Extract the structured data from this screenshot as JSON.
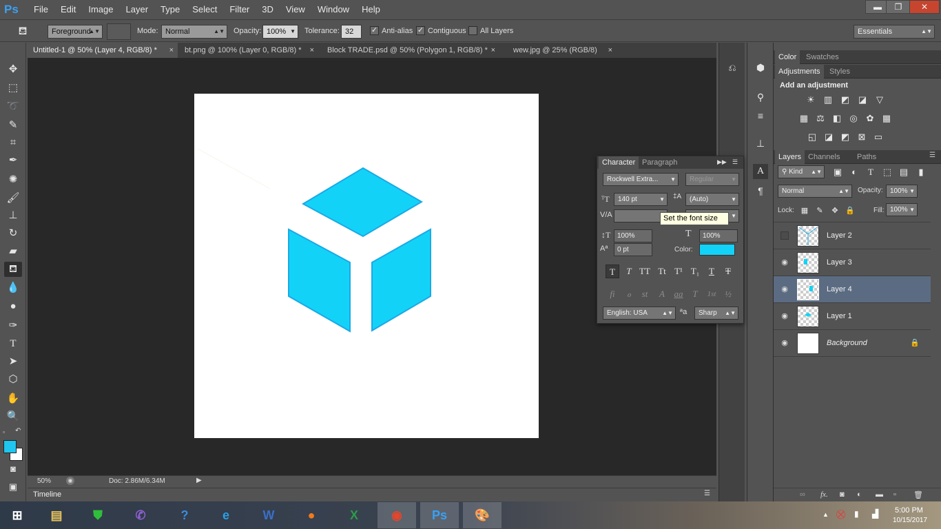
{
  "app": {
    "logo": "Ps"
  },
  "menu": [
    "File",
    "Edit",
    "Image",
    "Layer",
    "Type",
    "Select",
    "Filter",
    "3D",
    "View",
    "Window",
    "Help"
  ],
  "window_controls": {
    "minimize": "▬",
    "restore": "❐",
    "close": "✕"
  },
  "options_bar": {
    "tool_icon": "paint-bucket-icon",
    "fill_source": "Foreground",
    "mode_label": "Mode:",
    "mode_value": "Normal",
    "opacity_label": "Opacity:",
    "opacity_value": "100%",
    "tolerance_label": "Tolerance:",
    "tolerance_value": "32",
    "antialias_label": "Anti-alias",
    "contiguous_label": "Contiguous",
    "all_layers_label": "All Layers",
    "workspace": "Essentials"
  },
  "doc_tabs": [
    {
      "label": "Untitled-1 @ 50% (Layer 4, RGB/8) *",
      "close": "×"
    },
    {
      "label": "bt.png @ 100% (Layer 0, RGB/8) *",
      "close": "×"
    },
    {
      "label": "Block TRADE.psd @ 50% (Polygon 1, RGB/8) *",
      "close": "×"
    },
    {
      "label": "wew.jpg @ 25% (RGB/8)",
      "close": "×"
    }
  ],
  "tools": [
    "move-tool",
    "marquee-tool",
    "lasso-tool",
    "quick-select-tool",
    "crop-tool",
    "eyedropper-tool",
    "healing-brush-tool",
    "brush-tool",
    "clone-stamp-tool",
    "history-brush-tool",
    "eraser-tool",
    "paint-bucket-tool",
    "blur-tool",
    "dodge-tool",
    "pen-tool",
    "type-tool",
    "path-select-tool",
    "shape-tool",
    "hand-tool",
    "zoom-tool"
  ],
  "colors": {
    "foreground": "#1fc6f0",
    "background": "#ffffff",
    "cube": "#12d3f7",
    "cube_edge": "#1aa9e6",
    "selection": "#5b6b82"
  },
  "status": {
    "zoom": "50%",
    "doc": "Doc: 2.86M/6.34M"
  },
  "timeline": {
    "label": "Timeline"
  },
  "panels": {
    "color_tabs": [
      "Color",
      "Swatches"
    ],
    "adj_tabs": [
      "Adjustments",
      "Styles"
    ],
    "adj_title": "Add an adjustment",
    "layers_tabs": [
      "Layers",
      "Channels",
      "Paths"
    ],
    "kind_label": "Kind",
    "blend_mode": "Normal",
    "opacity_label": "Opacity:",
    "opacity_value": "100%",
    "lock_label": "Lock:",
    "fill_label": "Fill:",
    "fill_value": "100%",
    "layers": [
      {
        "name": "Layer 2",
        "visible": false,
        "selected": false
      },
      {
        "name": "Layer 3",
        "visible": true,
        "selected": false
      },
      {
        "name": "Layer 4",
        "visible": true,
        "selected": true
      },
      {
        "name": "Layer 1",
        "visible": true,
        "selected": false
      },
      {
        "name": "Background",
        "visible": true,
        "selected": false,
        "locked": true
      }
    ]
  },
  "character": {
    "tabs": [
      "Character",
      "Paragraph"
    ],
    "font_family": "Rockwell Extra...",
    "font_style": "Regular",
    "font_size": "140 pt",
    "leading": "(Auto)",
    "vert_scale": "100%",
    "horiz_scale": "100%",
    "baseline": "0 pt",
    "color_label": "Color:",
    "text_color": "#12d3f7",
    "language": "English: USA",
    "antialias": "Sharp",
    "type_styles": [
      "T",
      "T",
      "TT",
      "Tt",
      "T¹",
      "T₁",
      "T",
      "T"
    ],
    "opentype": [
      "fi",
      "ℴ",
      "st",
      "A",
      "aa",
      "T",
      "1st",
      "½"
    ],
    "tooltip": "Set the font size"
  },
  "taskbar": {
    "apps": [
      "windows-start",
      "file-explorer",
      "store",
      "viber",
      "help",
      "internet-explorer",
      "word",
      "firefox",
      "excel",
      "chrome",
      "photoshop",
      "paint"
    ],
    "time": "5:00 PM",
    "date": "10/15/2017"
  }
}
